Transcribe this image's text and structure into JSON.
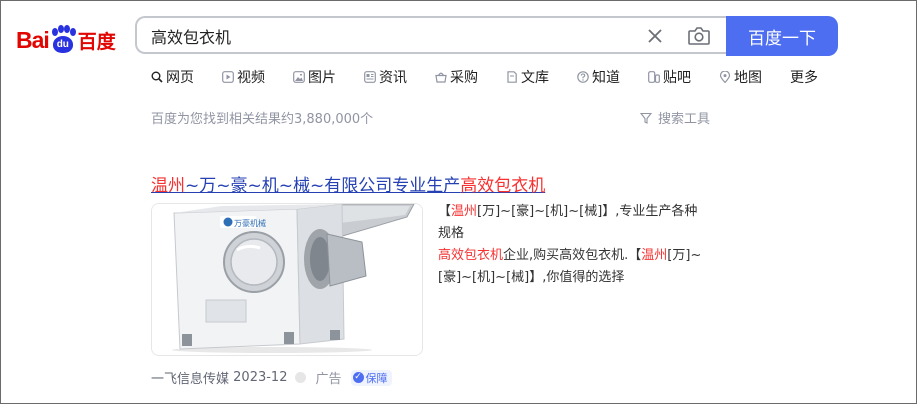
{
  "logo": {
    "text_latin": "Bai",
    "text_paw": "du",
    "text_cn": "百度"
  },
  "search": {
    "query": "高效包衣机",
    "button_label": "百度一下"
  },
  "tabs": [
    {
      "label": "网页",
      "icon": "search-icon"
    },
    {
      "label": "视频",
      "icon": "video-icon"
    },
    {
      "label": "图片",
      "icon": "image-icon"
    },
    {
      "label": "资讯",
      "icon": "news-icon"
    },
    {
      "label": "采购",
      "icon": "shopping-basket-icon"
    },
    {
      "label": "文库",
      "icon": "document-icon"
    },
    {
      "label": "知道",
      "icon": "question-icon"
    },
    {
      "label": "贴吧",
      "icon": "forum-icon"
    },
    {
      "label": "地图",
      "icon": "map-pin-icon"
    },
    {
      "label": "更多",
      "icon": ""
    }
  ],
  "results_count": "百度为您找到相关结果约3,880,000个",
  "search_tools_label": "搜索工具",
  "result": {
    "title_hl_1": "温州",
    "title_mid": "~万~豪~机~械~有限公司专业生产",
    "title_hl_2": "高效包衣机",
    "desc_1": "【",
    "desc_hl_1": "温州",
    "desc_2": "[万]~[豪]~[机]~[械]】,专业生产各种规格",
    "desc_hl_2": "高效包衣机",
    "desc_3": "企业,购买高效包衣机.【",
    "desc_hl_3": "温州",
    "desc_4": "[万]~[豪]~[机]~[械]】,你值得的选择",
    "source": "一飞信息传媒",
    "date": "2023-12",
    "ad_label": "广告",
    "badge_label": "保障",
    "machine_brand": "万豪机械"
  }
}
